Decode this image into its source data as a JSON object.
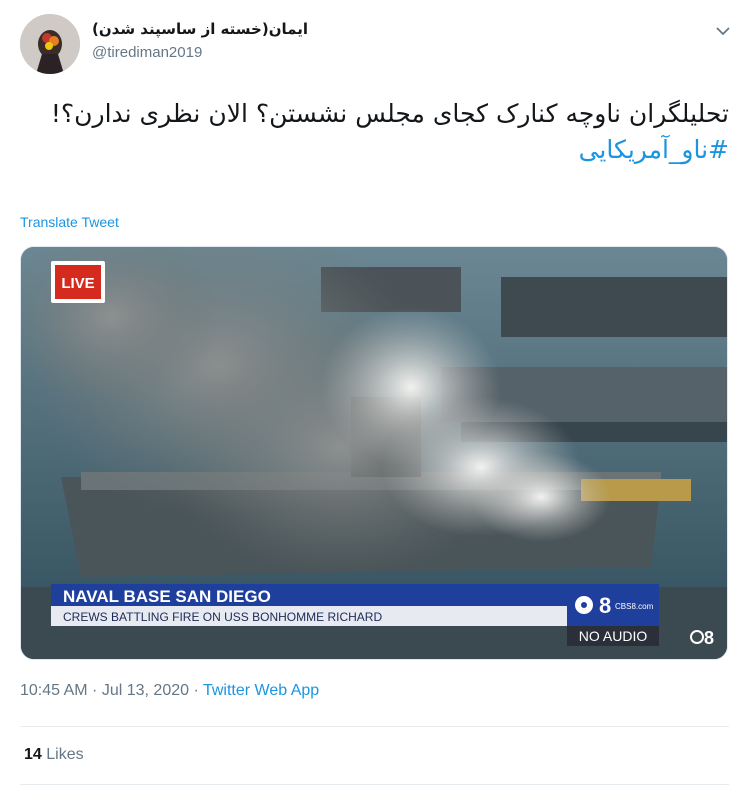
{
  "user": {
    "display_name": "ایمان(خسته از ساسپند شدن)",
    "handle": "@tirediman2019"
  },
  "tweet": {
    "text": "تحلیلگران ناوچه کنارک کجای مجلس نشستن؟ الان نظری ندارن؟!",
    "hashtag": "#ناو_آمریکایی",
    "translate_label": "Translate Tweet"
  },
  "media": {
    "live_badge": "LIVE",
    "lower_third_title": "NAVAL BASE SAN DIEGO",
    "lower_third_subtitle": "CREWS BATTLING FIRE ON USS BONHOMME RICHARD",
    "channel_logo": "8",
    "channel_site": "CBS8.com",
    "no_audio": "NO AUDIO",
    "corner_logo": "8"
  },
  "meta": {
    "time": "10:45 AM",
    "separator": " · ",
    "date": "Jul 13, 2020",
    "source": "Twitter Web App"
  },
  "stats": {
    "likes_count": "14",
    "likes_label": "Likes"
  },
  "icons": {
    "caret": "chevron-down-icon",
    "avatar": "avatar"
  },
  "colors": {
    "link": "#1b95e0",
    "secondary_text": "#657786",
    "primary_text": "#14171a",
    "live_red": "#d52a1e",
    "banner_blue": "#1e3f9c"
  }
}
